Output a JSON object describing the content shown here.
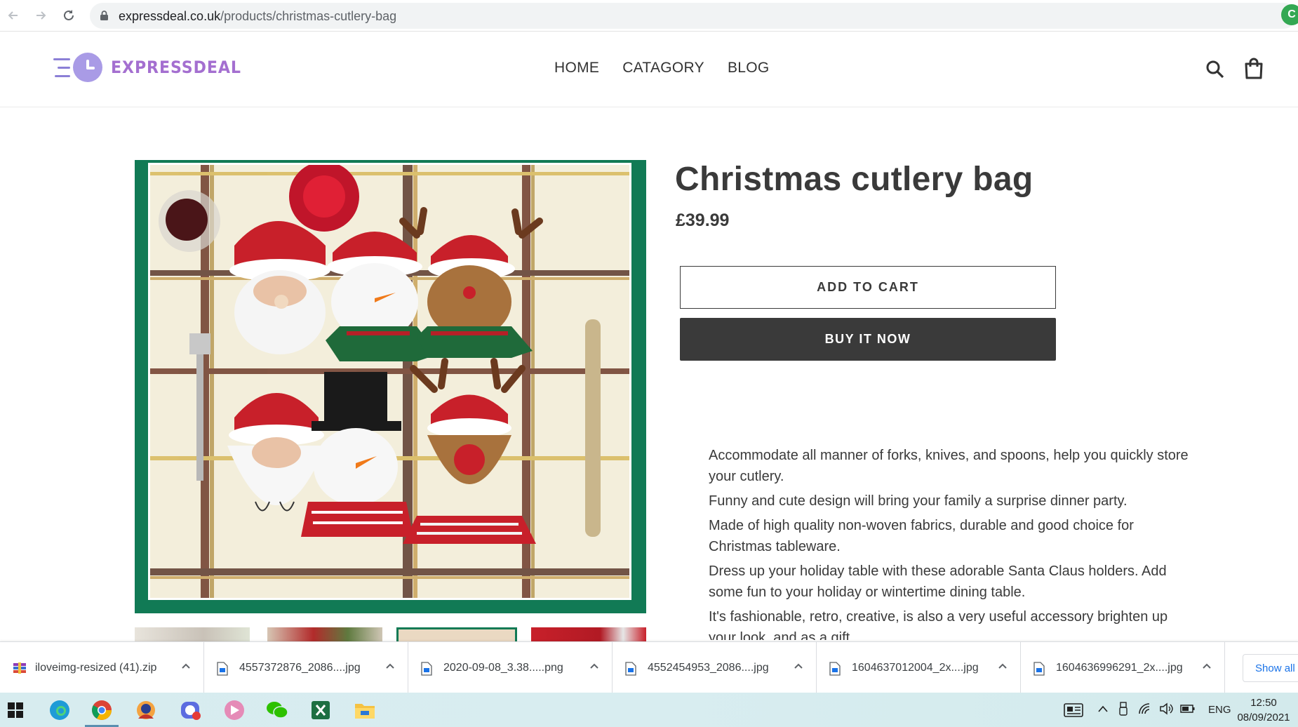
{
  "browser": {
    "url_host": "expressdeal.co.uk",
    "url_path": "/products/christmas-cutlery-bag",
    "profile_initial": "C"
  },
  "site": {
    "logo_text": "EXPRESSDEAL",
    "nav": [
      "HOME",
      "CATAGORY",
      "BLOG"
    ]
  },
  "product": {
    "title": "Christmas cutlery bag",
    "price": "£39.99",
    "add_to_cart_label": "ADD TO CART",
    "buy_now_label": "BUY IT NOW",
    "bullets": [
      "Accommodate all manner of forks, knives, and spoons, help you quickly store your cutlery.",
      "Funny and cute design will bring your family a surprise dinner party.",
      "Made of high quality non-woven fabrics, durable and good choice for Christmas tableware.",
      "Dress up your holiday table with these adorable Santa Claus holders. Add some fun to your holiday or wintertime dining table.",
      "It's fashionable, retro, creative, is also a very useful accessory brighten up your look, and as a gift"
    ]
  },
  "downloads": {
    "items": [
      {
        "name": "iloveimg-resized (41).zip",
        "type": "zip"
      },
      {
        "name": "4557372876_2086....jpg",
        "type": "file"
      },
      {
        "name": "2020-09-08_3.38.....png",
        "type": "file"
      },
      {
        "name": "4552454953_2086....jpg",
        "type": "file"
      },
      {
        "name": "1604637012004_2x....jpg",
        "type": "file"
      },
      {
        "name": "1604636996291_2x....jpg",
        "type": "file"
      }
    ],
    "show_all_label": "Show all"
  },
  "taskbar": {
    "language": "ENG",
    "time": "12:50",
    "date": "08/09/2021"
  },
  "colors": {
    "brand_purple": "#a46fd0",
    "image_frame_green": "#117a55",
    "button_dark": "#3a3a3a"
  }
}
